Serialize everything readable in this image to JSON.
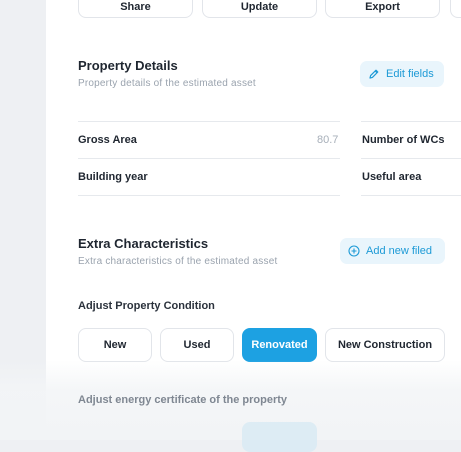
{
  "toolbar": {
    "share_label": "Share",
    "update_label": "Update",
    "export_label": "Export"
  },
  "property_details": {
    "title": "Property Details",
    "subtitle": "Property details of the estimated asset",
    "edit_label": "Edit fields",
    "edit_icon": "pencil-icon",
    "fields_left": [
      {
        "label": "Gross Area",
        "value": "80.7"
      },
      {
        "label": "Building year",
        "value": ""
      }
    ],
    "fields_right": [
      {
        "label": "Number of WCs",
        "value": ""
      },
      {
        "label": "Useful area",
        "value": ""
      }
    ]
  },
  "extra": {
    "title": "Extra Characteristics",
    "subtitle": "Extra characteristics of the estimated asset",
    "add_label": "Add new filed",
    "add_icon": "plus-circle-icon"
  },
  "condition": {
    "label": "Adjust Property Condition",
    "options": [
      "New",
      "Used",
      "Renovated",
      "New Construction"
    ],
    "selected": "Renovated"
  },
  "energy": {
    "label": "Adjust energy certificate of the property"
  },
  "colors": {
    "accent": "#1da1e2",
    "accent_soft": "#e9f5fc",
    "text": "#1f2630",
    "muted": "#9aa3ae"
  }
}
